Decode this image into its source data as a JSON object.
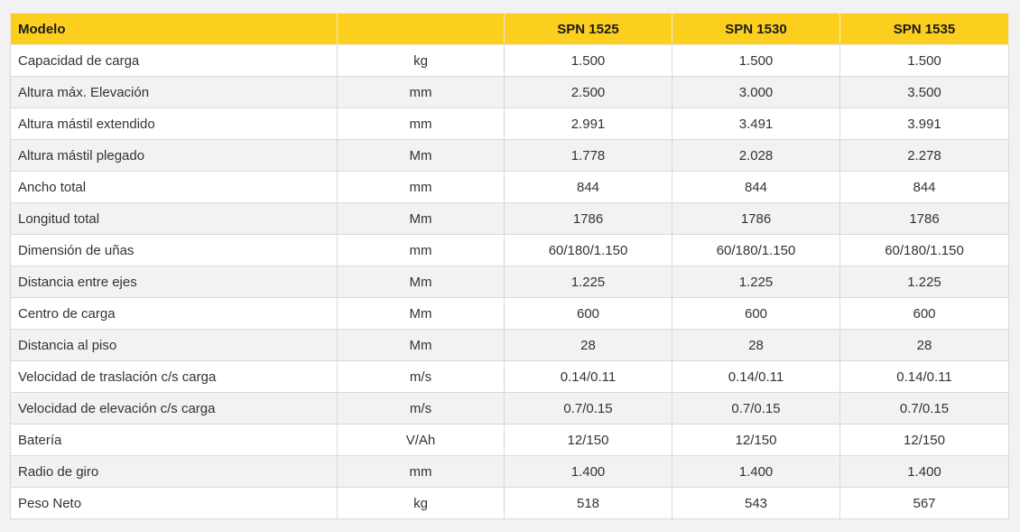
{
  "header": {
    "label": "Modelo",
    "unit": "",
    "models": [
      "SPN 1525",
      "SPN 1530",
      "SPN 1535"
    ]
  },
  "rows": [
    {
      "label": "Capacidad de carga",
      "unit": "kg",
      "values": [
        "1.500",
        "1.500",
        "1.500"
      ]
    },
    {
      "label": "Altura máx. Elevación",
      "unit": "mm",
      "values": [
        "2.500",
        "3.000",
        "3.500"
      ]
    },
    {
      "label": "Altura mástil extendido",
      "unit": "mm",
      "values": [
        "2.991",
        "3.491",
        "3.991"
      ]
    },
    {
      "label": "Altura mástil plegado",
      "unit": "Mm",
      "values": [
        "1.778",
        "2.028",
        "2.278"
      ]
    },
    {
      "label": "Ancho total",
      "unit": "mm",
      "values": [
        "844",
        "844",
        "844"
      ]
    },
    {
      "label": "Longitud total",
      "unit": "Mm",
      "values": [
        "1786",
        "1786",
        "1786"
      ]
    },
    {
      "label": "Dimensión de uñas",
      "unit": "mm",
      "values": [
        "60/180/1.150",
        "60/180/1.150",
        "60/180/1.150"
      ]
    },
    {
      "label": "Distancia entre ejes",
      "unit": "Mm",
      "values": [
        "1.225",
        "1.225",
        "1.225"
      ]
    },
    {
      "label": "Centro de carga",
      "unit": "Mm",
      "values": [
        "600",
        "600",
        "600"
      ]
    },
    {
      "label": "Distancia al piso",
      "unit": "Mm",
      "values": [
        "28",
        "28",
        "28"
      ]
    },
    {
      "label": "Velocidad de traslación c/s carga",
      "unit": "m/s",
      "values": [
        "0.14/0.11",
        "0.14/0.11",
        "0.14/0.11"
      ]
    },
    {
      "label": "Velocidad de elevación c/s carga",
      "unit": "m/s",
      "values": [
        "0.7/0.15",
        "0.7/0.15",
        "0.7/0.15"
      ]
    },
    {
      "label": "Batería",
      "unit": "V/Ah",
      "values": [
        "12/150",
        "12/150",
        "12/150"
      ]
    },
    {
      "label": "Radio de giro",
      "unit": "mm",
      "values": [
        "1.400",
        "1.400",
        "1.400"
      ]
    },
    {
      "label": "Peso Neto",
      "unit": "kg",
      "values": [
        "518",
        "543",
        "567"
      ]
    }
  ],
  "colors": {
    "header_bg": "#fccf1e",
    "row_alt_bg": "#f2f2f2",
    "row_bg": "#ffffff",
    "text": "#333333"
  }
}
